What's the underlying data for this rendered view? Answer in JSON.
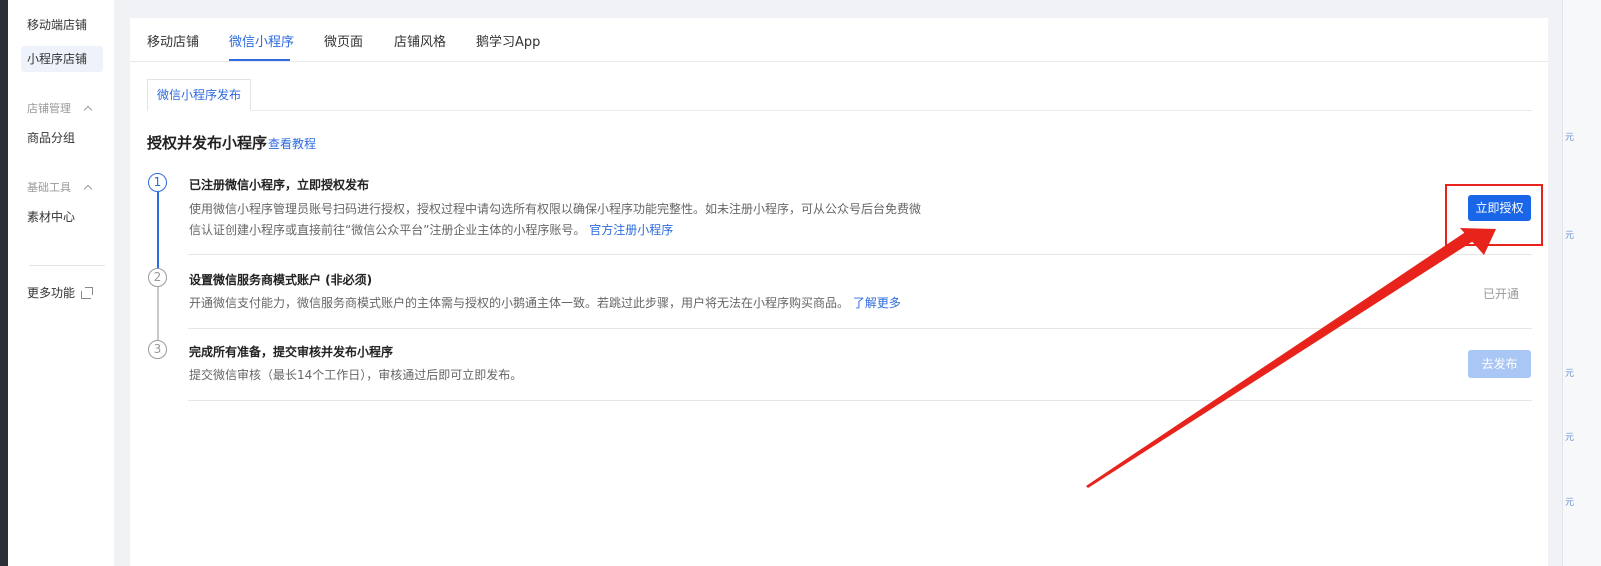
{
  "sidebar": {
    "items": [
      {
        "label": "移动端店铺"
      },
      {
        "label": "小程序店铺",
        "active": true
      }
    ],
    "groups": [
      {
        "label": "店铺管理",
        "items": [
          "商品分组"
        ]
      },
      {
        "label": "基础工具",
        "items": [
          "素材中心"
        ]
      }
    ],
    "more_label": "更多功能"
  },
  "tabs": [
    {
      "label": "移动店铺"
    },
    {
      "label": "微信小程序",
      "active": true
    },
    {
      "label": "微页面"
    },
    {
      "label": "店铺风格"
    },
    {
      "label": "鹅学习App"
    }
  ],
  "subtab": {
    "label": "微信小程序发布"
  },
  "section": {
    "title": "授权并发布小程序",
    "tutorial_link": "查看教程"
  },
  "steps": [
    {
      "number": "1",
      "title": "已注册微信小程序，立即授权发布",
      "desc_line1": "使用微信小程序管理员账号扫码进行授权，授权过程中请勾选所有权限以确保小程序功能完整性。如未注册小程序，可从公众号后台免费微",
      "desc_line2": "信认证创建小程序或直接前往“微信公众平台”注册企业主体的小程序账号。",
      "link": "官方注册小程序",
      "action": "立即授权"
    },
    {
      "number": "2",
      "title": "设置微信服务商模式账户 (非必须)",
      "desc_line1": "开通微信支付能力，微信服务商模式账户的主体需与授权的小鹅通主体一致。若跳过此步骤，用户将无法在小程序购买商品。",
      "link": "了解更多",
      "status": "已开通"
    },
    {
      "number": "3",
      "title": "完成所有准备，提交审核并发布小程序",
      "desc_line1": "提交微信审核（最长14个工作日），审核通过后即可立即发布。",
      "action": "去发布"
    }
  ],
  "right_marks": [
    "元",
    "元",
    "元",
    "元",
    "元"
  ],
  "colors": {
    "accent": "#2d6be0",
    "primary_button": "#1a66e8",
    "disabled_button": "#a9c6f5",
    "annotation": "#e8231c"
  }
}
